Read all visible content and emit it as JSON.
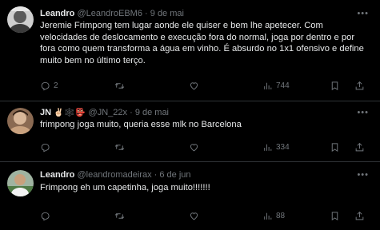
{
  "tweets": [
    {
      "name": "Leandro",
      "handle": "@LeandroEBM6",
      "separator": "·",
      "date": "9 de mai",
      "emojis": "",
      "text": "Jeremie Frimpong tem lugar aonde ele quiser e bem lhe apetecer. Com velocidades de deslocamento e execução fora do normal, joga por dentro e por fora como quem transforma a água em vinho. É absurdo no 1x1 ofensivo e define muito bem no último terço.",
      "replies": "2",
      "retweets": "",
      "likes": "",
      "views": "744"
    },
    {
      "name": "JN",
      "handle": "@JN_22x",
      "separator": "·",
      "date": "9 de mai",
      "emojis": "✌🏻🕸️👺",
      "text": "frimpong joga muito, queria esse mlk no Barcelona",
      "replies": "",
      "retweets": "",
      "likes": "",
      "views": "334"
    },
    {
      "name": "Leandro",
      "handle": "@leandromadeirax",
      "separator": "·",
      "date": "6 de jun",
      "emojis": "",
      "text": "Frimpong eh um capetinha, joga muito!!!!!!!",
      "replies": "",
      "retweets": "",
      "likes": "",
      "views": "88"
    }
  ],
  "icons": {
    "more": "more-horizontal-icon",
    "reply": "reply-icon",
    "retweet": "retweet-icon",
    "like": "heart-icon",
    "views": "views-bar-chart-icon",
    "bookmark": "bookmark-icon",
    "share": "share-icon"
  },
  "colors": {
    "background": "#000000",
    "text": "#e7e9ea",
    "muted": "#71767b",
    "divider": "#2f3336"
  }
}
